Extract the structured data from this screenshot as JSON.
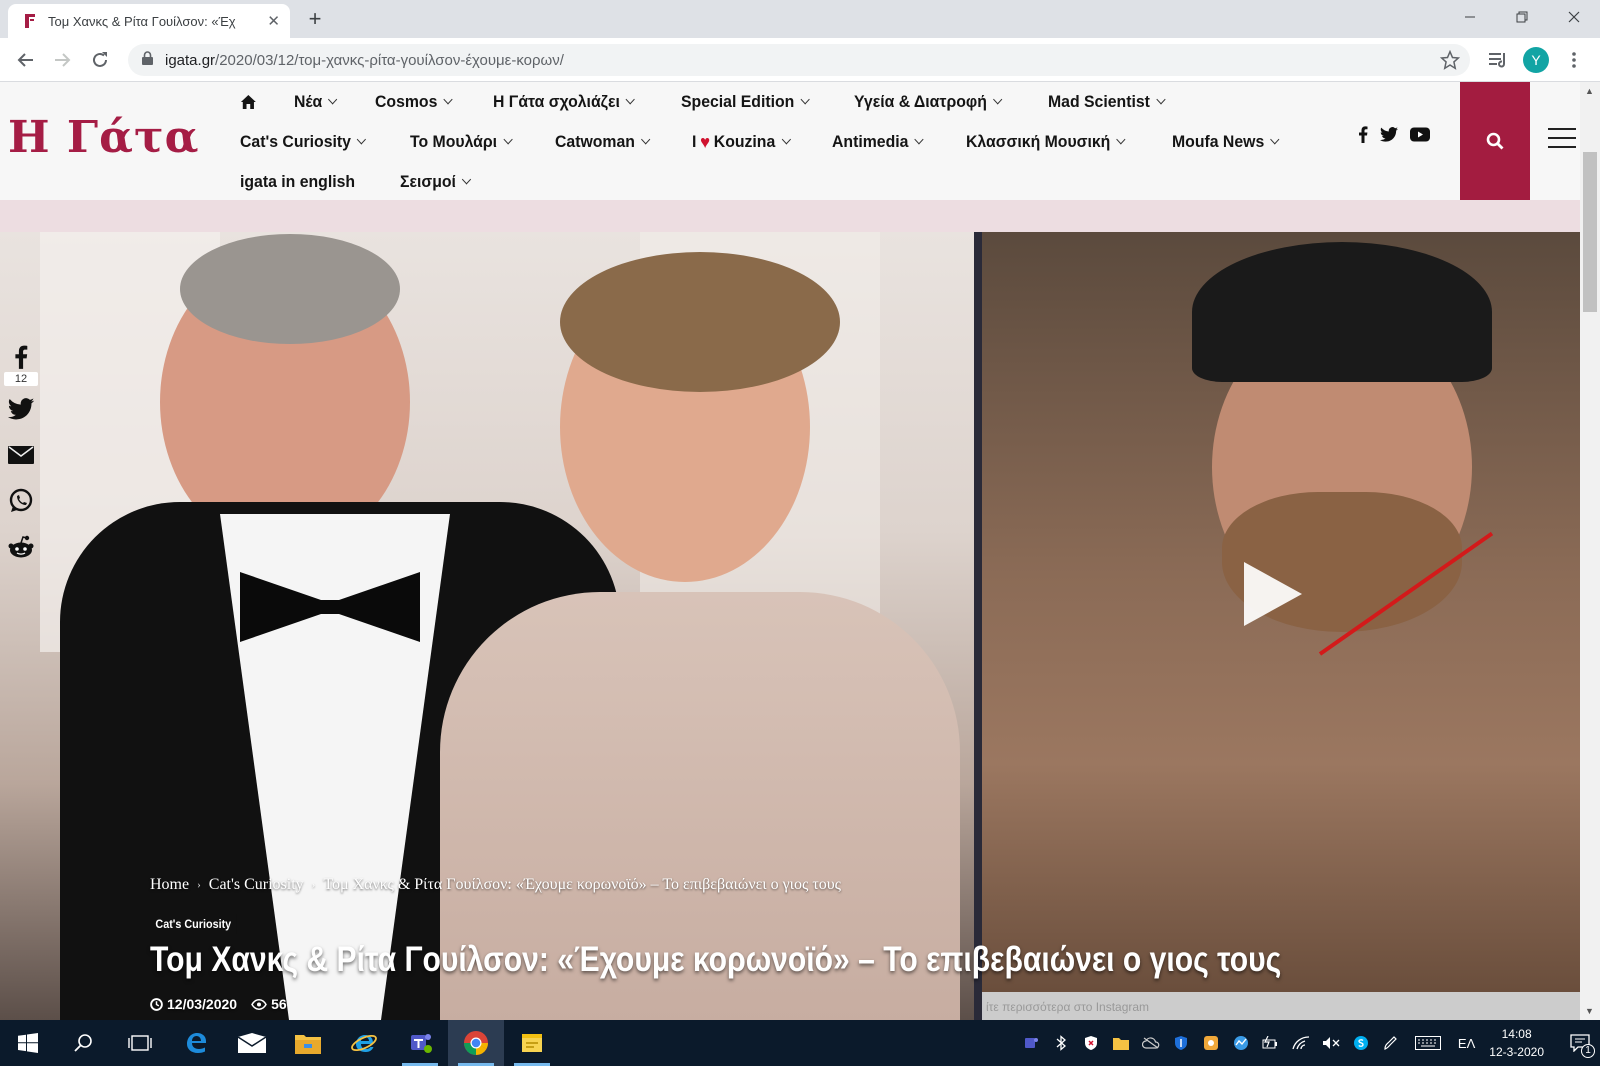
{
  "browser": {
    "tab_title": "Τομ Χανκς & Ρίτα Γουίλσον: «Έχ",
    "url_host": "igata.gr",
    "url_path": "/2020/03/12/τομ-χανκς-ρίτα-γουίλσον-έχουμε-κορων/",
    "profile_initial": "Y"
  },
  "site": {
    "logo": "Η Γάτα",
    "menu_row1": [
      "Νέα",
      "Cosmos",
      "Η Γάτα σχολιάζει",
      "Special Edition",
      "Υγεία & Διατροφή",
      "Mad Scientist"
    ],
    "menu_row2": {
      "items": [
        "Cat's Curiosity",
        "Το Μουλάρι",
        "Catwoman"
      ],
      "kouzina_prefix": "I",
      "kouzina_label": "Kouzina",
      "items_after": [
        "Antimedia",
        "Κλασσική Μουσική",
        "Moufa News"
      ]
    },
    "menu_row3": [
      "igata in english",
      "Σεισμοί"
    ]
  },
  "share": {
    "facebook_count": "12"
  },
  "article": {
    "breadcrumb": [
      "Home",
      "Cat's Curiosity",
      "Τομ Χανκς & Ρίτα Γουίλσον: «Έχουμε κορωνοϊό» – Το επιβεβαιώνει ο γιος τους"
    ],
    "category": "Cat's Curiosity",
    "headline": "Τομ Χανκς & Ρίτα Γουίλσον: «Έχουμε κορωνοϊό» – Το επιβεβαιώνει ο γιος τους",
    "date": "12/03/2020",
    "views": "56",
    "instagram_caption": "ίτε περισσότερα στο Instagram"
  },
  "taskbar": {
    "language": "ΕΛ",
    "time": "14:08",
    "date": "12-3-2020",
    "notification_count": "1"
  },
  "colors": {
    "brand": "#a51d45",
    "search_bg": "#a31c40",
    "band": "#eddde1",
    "taskbar": "#0b1a2b"
  }
}
